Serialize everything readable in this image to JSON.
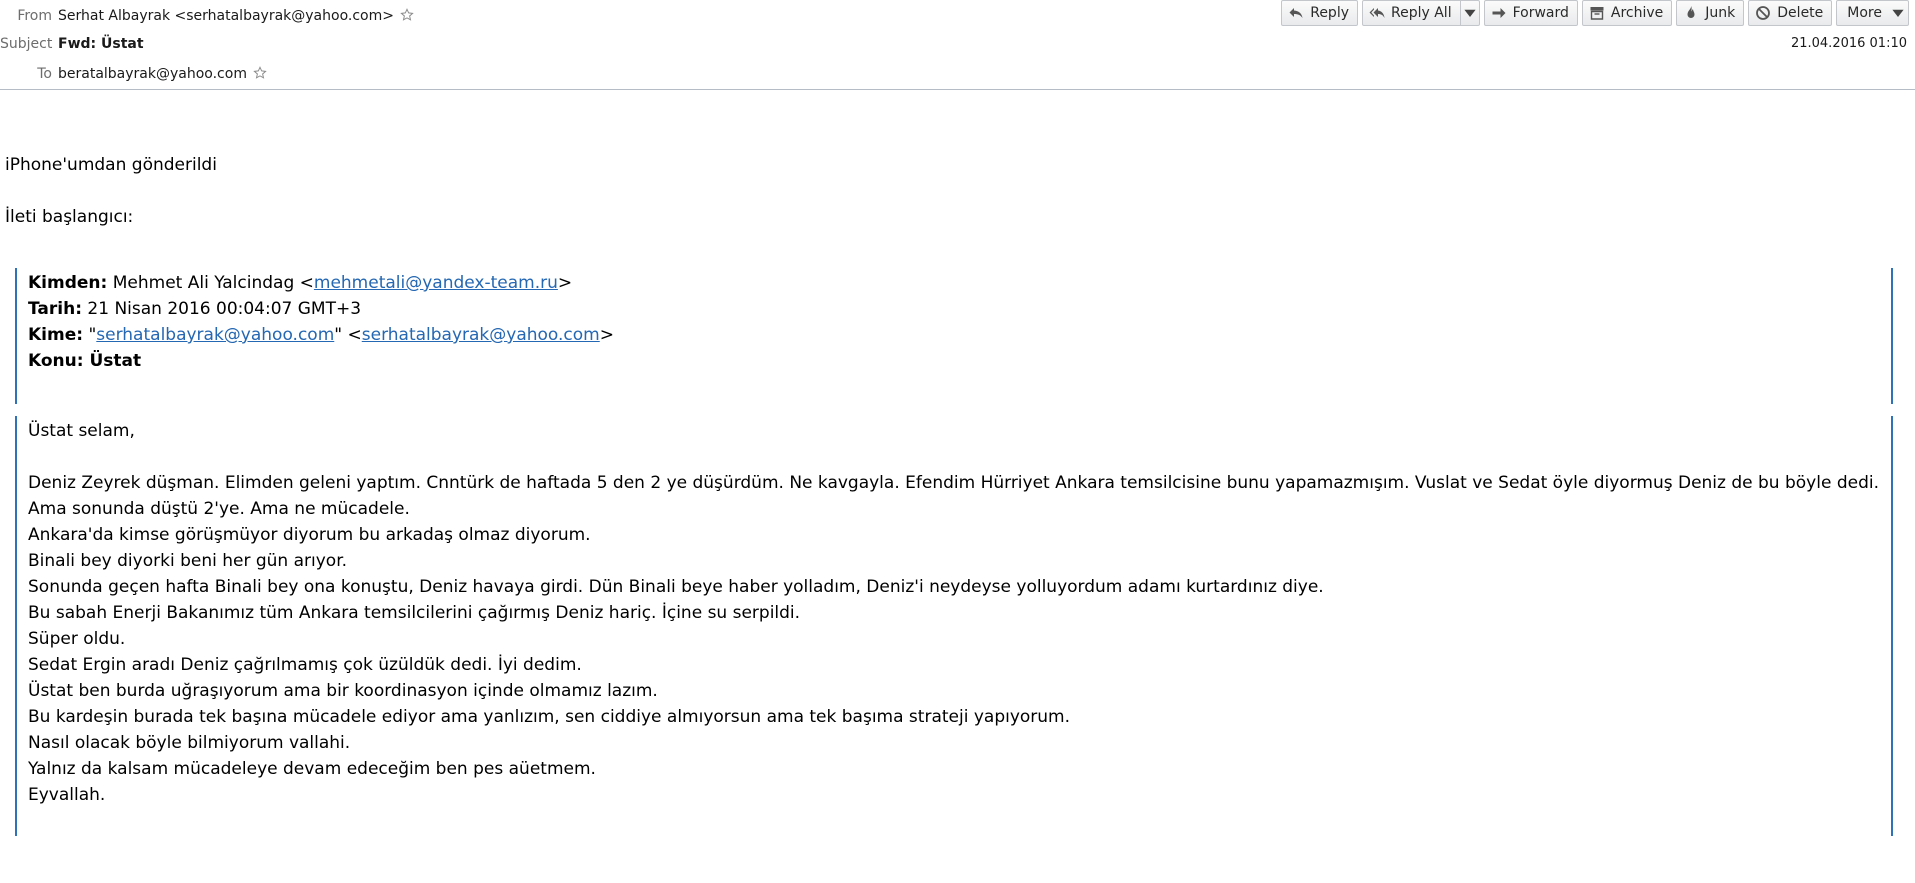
{
  "header": {
    "from_label": "From",
    "from_value": "Serhat Albayrak <serhatalbayrak@yahoo.com>",
    "subject_label": "Subject",
    "subject_value": "Fwd: Üstat",
    "to_label": "To",
    "to_value": "beratalbayrak@yahoo.com",
    "date": "21.04.2016 01:10"
  },
  "toolbar": {
    "reply": "Reply",
    "reply_all": "Reply All",
    "forward": "Forward",
    "archive": "Archive",
    "junk": "Junk",
    "delete": "Delete",
    "more": "More"
  },
  "message": {
    "sent_from": "iPhone'umdan gönderildi",
    "forward_start": "İleti başlangıcı:",
    "kimden_label": "Kimden:",
    "kimden_name": " Mehmet Ali Yalcindag <",
    "kimden_email": "mehmetali@yandex-team.ru",
    "kimden_end": ">",
    "tarih_label": "Tarih:",
    "tarih_value": " 21 Nisan 2016 00:04:07 GMT+3",
    "kime_label": "Kime:",
    "kime_q1": " \"",
    "kime_email1": "serhatalbayrak@yahoo.com",
    "kime_mid": "\" <",
    "kime_email2": "serhatalbayrak@yahoo.com",
    "kime_end": ">",
    "konu_label": "Konu:",
    "konu_value": " Üstat",
    "body_lines": [
      "Üstat selam,",
      "",
      "Deniz Zeyrek düşman. Elimden geleni yaptım. Cnntürk de haftada 5 den 2 ye düşürdüm. Ne kavgayla. Efendim Hürriyet Ankara temsilcisine bunu yapamazmışım. Vuslat ve Sedat öyle diyormuş Deniz de bu böyle dedi.",
      "Ama sonunda düştü 2'ye. Ama ne mücadele.",
      "Ankara'da kimse görüşmüyor diyorum bu arkadaş olmaz diyorum.",
      "Binali bey diyorki beni her gün arıyor.",
      "Sonunda geçen hafta Binali bey ona konuştu, Deniz havaya girdi. Dün Binali beye haber yolladım, Deniz'i neydeyse yolluyordum adamı kurtardınız diye.",
      "Bu sabah Enerji Bakanımız tüm Ankara temsilcilerini çağırmış Deniz hariç. İçine su serpildi.",
      "Süper oldu.",
      "Sedat Ergin aradı Deniz çağrılmamış çok üzüldük dedi. İyi dedim.",
      "Üstat ben burda uğraşıyorum ama bir koordinasyon içinde olmamız lazım.",
      "Bu kardeşin burada tek başına mücadele ediyor ama yanlızım, sen ciddiye almıyorsun ama tek başıma strateji yapıyorum.",
      "Nasıl olacak böyle bilmiyorum vallahi.",
      "Yalnız da kalsam mücadeleye devam edeceğim ben pes aüetmem.",
      "Eyvallah."
    ]
  }
}
